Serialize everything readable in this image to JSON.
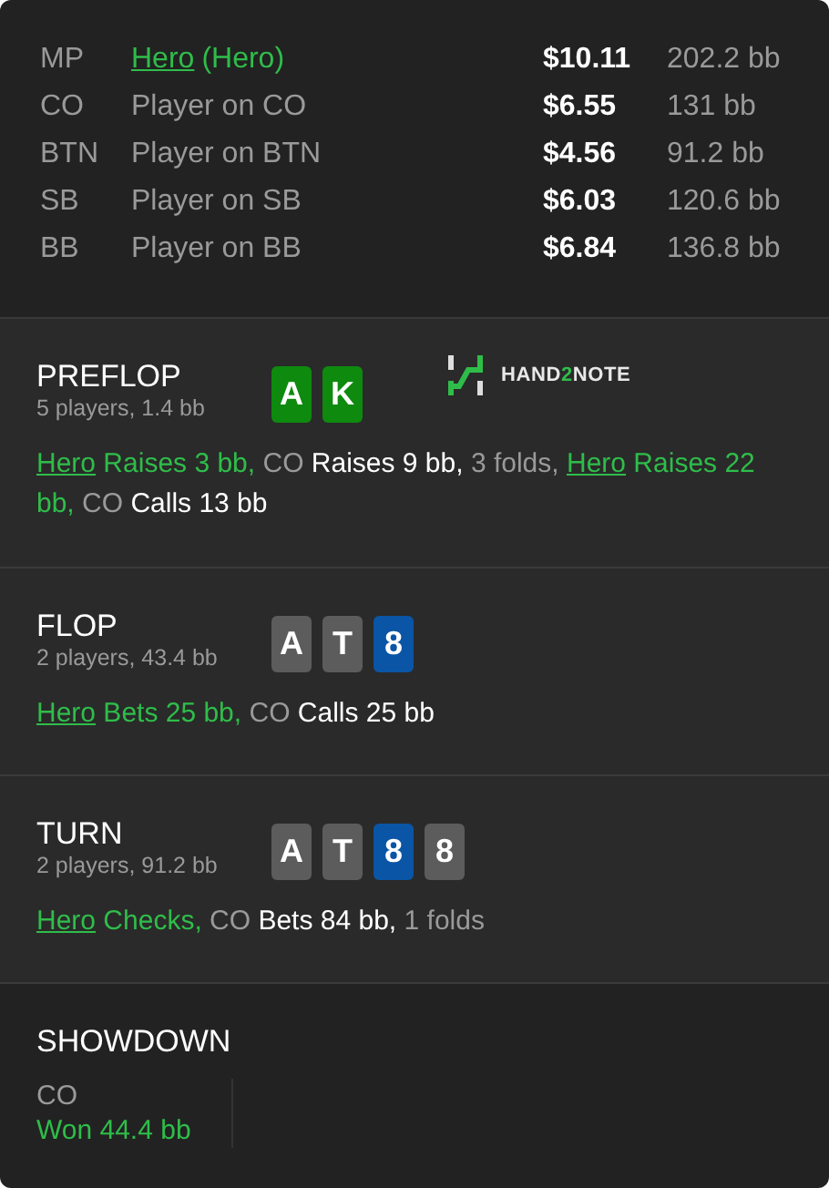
{
  "players": [
    {
      "position": "MP",
      "name": "Hero",
      "note": "(Hero)",
      "is_hero": true,
      "stack": "$10.11",
      "stack_bb": "202.2 bb"
    },
    {
      "position": "CO",
      "name": "Player on CO",
      "is_hero": false,
      "stack": "$6.55",
      "stack_bb": "131 bb"
    },
    {
      "position": "BTN",
      "name": "Player on BTN",
      "is_hero": false,
      "stack": "$4.56",
      "stack_bb": "91.2 bb"
    },
    {
      "position": "SB",
      "name": "Player on SB",
      "is_hero": false,
      "stack": "$6.03",
      "stack_bb": "120.6 bb"
    },
    {
      "position": "BB",
      "name": "Player on BB",
      "is_hero": false,
      "stack": "$6.84",
      "stack_bb": "136.8 bb"
    }
  ],
  "streets": [
    {
      "name": "PREFLOP",
      "summary": "5 players, 1.4 bb",
      "cards": [
        {
          "rank": "A",
          "color": "#0e8a0e"
        },
        {
          "rank": "K",
          "color": "#0e8a0e"
        }
      ],
      "logo": {
        "before": "HAND",
        "highlight": "2",
        "after": "NOTE"
      },
      "actions": [
        {
          "kind": "hero",
          "actor": "Hero",
          "text": "Raises 3 bb,"
        },
        {
          "kind": "player",
          "actor": "CO",
          "text": "Raises 9 bb,"
        },
        {
          "kind": "folds",
          "text": "3 folds,"
        },
        {
          "kind": "hero",
          "actor": "Hero",
          "text": "Raises 22 bb,"
        },
        {
          "kind": "player",
          "actor": "CO",
          "text": "Calls 13 bb"
        }
      ]
    },
    {
      "name": "FLOP",
      "summary": "2 players, 43.4 bb",
      "cards": [
        {
          "rank": "A",
          "color": "#5c5c5c"
        },
        {
          "rank": "T",
          "color": "#5c5c5c"
        },
        {
          "rank": "8",
          "color": "#0a55a5"
        }
      ],
      "actions": [
        {
          "kind": "hero",
          "actor": "Hero",
          "text": "Bets 25 bb,"
        },
        {
          "kind": "player",
          "actor": "CO",
          "text": "Calls 25 bb"
        }
      ]
    },
    {
      "name": "TURN",
      "summary": "2 players, 91.2 bb",
      "cards": [
        {
          "rank": "A",
          "color": "#5c5c5c"
        },
        {
          "rank": "T",
          "color": "#5c5c5c"
        },
        {
          "rank": "8",
          "color": "#0a55a5"
        },
        {
          "rank": "8",
          "color": "#5c5c5c"
        }
      ],
      "actions": [
        {
          "kind": "hero",
          "actor": "Hero",
          "text": "Checks,"
        },
        {
          "kind": "player",
          "actor": "CO",
          "text": "Bets 84 bb,"
        },
        {
          "kind": "folds",
          "text": "1 folds"
        }
      ]
    }
  ],
  "showdown": {
    "title": "SHOWDOWN",
    "results": [
      {
        "player": "CO",
        "result": "Won 44.4 bb"
      }
    ]
  }
}
